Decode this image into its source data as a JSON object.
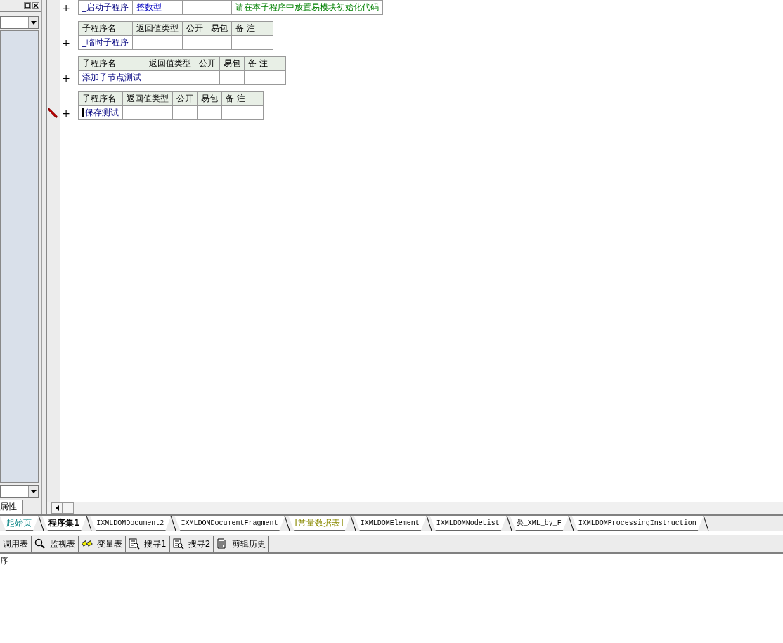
{
  "side_panel": {
    "tab": "属性"
  },
  "subroutines": [
    {
      "expander": "+",
      "name": "_启动子程序",
      "return_type": "整数型",
      "remark": "请在本子程序中放置易模块初始化代码",
      "editing": false
    },
    {
      "columns": [
        "子程序名",
        "返回值类型",
        "公开",
        "易包",
        "备 注"
      ],
      "expander": "+",
      "name": "_临时子程序",
      "editing": false
    },
    {
      "columns": [
        "子程序名",
        "返回值类型",
        "公开",
        "易包",
        "备 注"
      ],
      "expander": "+",
      "name": "添加子节点测试",
      "editing": false
    },
    {
      "columns": [
        "子程序名",
        "返回值类型",
        "公开",
        "易包",
        "备 注"
      ],
      "expander": "+",
      "name": "保存测试",
      "editing": true
    }
  ],
  "tabs": [
    {
      "label": "起始页",
      "kind": "start",
      "selected": false
    },
    {
      "label": "程序集1",
      "kind": "module",
      "selected": true
    },
    {
      "label": "IXMLDOMDocument2",
      "kind": "class",
      "selected": false
    },
    {
      "label": "IXMLDOMDocumentFragment",
      "kind": "class",
      "selected": false
    },
    {
      "label": "[常量数据表]",
      "kind": "constants",
      "selected": false
    },
    {
      "label": "IXMLDOMElement",
      "kind": "class",
      "selected": false
    },
    {
      "label": "IXMLDOMNodeList",
      "kind": "class",
      "selected": false
    },
    {
      "label": "类_XML_by_F",
      "kind": "class",
      "selected": false
    },
    {
      "label": "IXMLDOMProcessingInstruction",
      "kind": "class",
      "selected": false
    }
  ],
  "toolbar": [
    {
      "label": "调用表"
    },
    {
      "label": "监视表"
    },
    {
      "label": "变量表"
    },
    {
      "label": "搜寻1"
    },
    {
      "label": "搜寻2"
    },
    {
      "label": "剪辑历史"
    }
  ],
  "status_text": "序"
}
